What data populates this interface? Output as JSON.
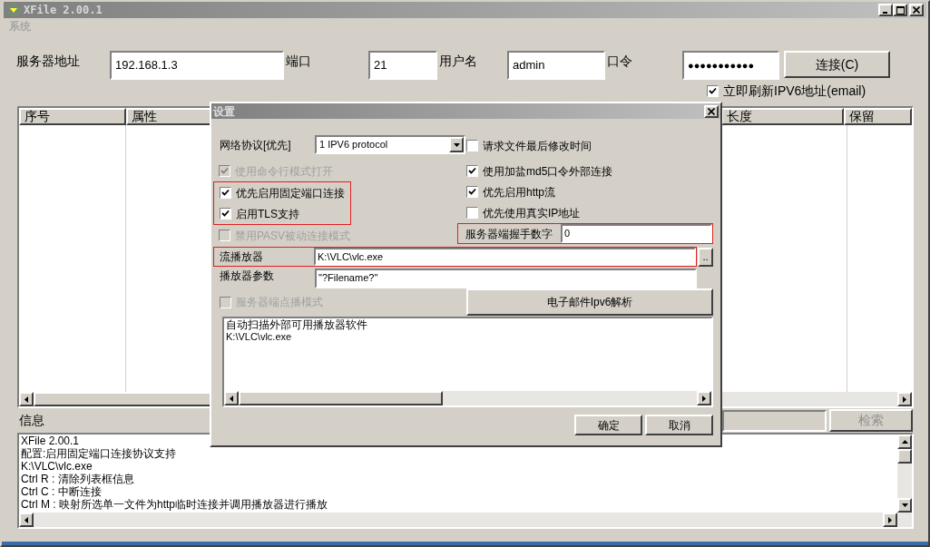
{
  "window": {
    "title": "XFile 2.00.1"
  },
  "menu": [
    {
      "label": "系统",
      "disabled": true
    }
  ],
  "connection": {
    "fields": [
      {
        "label": "服务器地址",
        "value": "192.168.1.3",
        "kind": "text"
      },
      {
        "label": "端口",
        "value": "21",
        "kind": "text"
      },
      {
        "label": "用户名",
        "value": "admin",
        "kind": "text"
      },
      {
        "label": "口令",
        "value": "●●●●●●●●●●●",
        "kind": "password"
      }
    ],
    "connect_button": "连接(C)",
    "refresh_ipv6": {
      "label": "立即刷新IPV6地址(email)",
      "checked": true
    }
  },
  "file_table": {
    "columns": [
      "序号",
      "属性",
      "长度",
      "保留"
    ]
  },
  "info": {
    "label": "信息",
    "search_button": {
      "label": "检索",
      "disabled": true
    },
    "log": [
      "XFile 2.00.1",
      "配置:启用固定端口连接协议支持",
      "K:\\VLC\\vlc.exe",
      "Ctrl R : 清除列表框信息",
      "Ctrl C : 中断连接",
      "Ctrl M : 映射所选单一文件为http临时连接并调用播放器进行播放"
    ]
  },
  "settings_dialog": {
    "title": "设置",
    "protocol": {
      "label": "网络协议[优先]",
      "value": "1 IPV6 protocol"
    },
    "left_options": [
      {
        "label": "使用命令行模式打开",
        "checked": true,
        "disabled": true,
        "highlighted": false
      },
      {
        "label": "优先启用固定端口连接",
        "checked": true,
        "disabled": false,
        "highlighted": true
      },
      {
        "label": "启用TLS支持",
        "checked": true,
        "disabled": false,
        "highlighted": true
      },
      {
        "label": "禁用PASV被动连接模式",
        "checked": false,
        "disabled": true,
        "highlighted": false
      }
    ],
    "right_options": [
      {
        "label": "请求文件最后修改时间",
        "checked": false,
        "disabled": false
      },
      {
        "label": "使用加盐md5口令外部连接",
        "checked": true,
        "disabled": false
      },
      {
        "label": "优先启用http流",
        "checked": true,
        "disabled": false
      },
      {
        "label": "优先使用真实IP地址",
        "checked": false,
        "disabled": false
      }
    ],
    "handshake": {
      "label": "服务器端握手数字",
      "value": "0",
      "highlighted": true
    },
    "stream_player": {
      "label": "流播放器",
      "value": "K:\\VLC\\vlc.exe",
      "browse_button": "..",
      "highlighted": true
    },
    "player_args": {
      "label": "播放器参数",
      "value": "\"?Filename?\""
    },
    "server_vod": {
      "label": "服务器端点播模式",
      "checked": false,
      "disabled": true
    },
    "email_button": "电子邮件Ipv6解析",
    "player_list": [
      "自动扫描外部可用播放器软件",
      "K:\\VLC\\vlc.exe"
    ],
    "buttons": [
      "确定",
      "取消"
    ]
  }
}
